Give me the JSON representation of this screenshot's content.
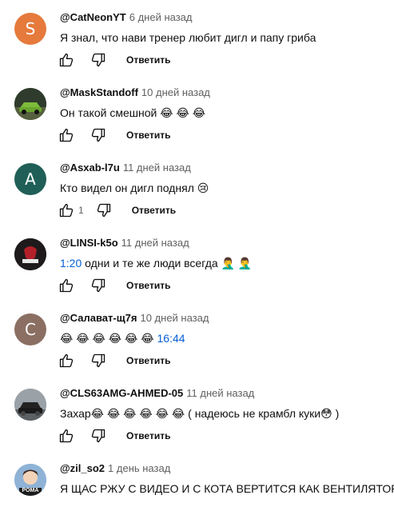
{
  "reply_label": "Ответить",
  "colors": {
    "link": "#065fd4",
    "muted": "#606060",
    "text": "#0f0f0f"
  },
  "comments": [
    {
      "author": "@CatNeonYT",
      "time": "6 дней назад",
      "text": "Я знал, что нави тренер любит дигл и папу гриба",
      "likes": "",
      "avatar_letter": "S",
      "avatar_color": "#e57a3c"
    },
    {
      "author": "@MaskStandoff",
      "time": "10 дней назад",
      "text": "Он такой смешной 😂 😂 😂",
      "likes": "",
      "avatar_letter": "",
      "avatar_color": "#3e5a3a",
      "avatar_icon": "green-car-photo"
    },
    {
      "author": "@Asxab-l7u",
      "time": "11 дней назад",
      "text": "Кто видел он дигл поднял 😢",
      "likes": "1",
      "avatar_letter": "A",
      "avatar_color": "#1f5f57"
    },
    {
      "author": "@LINSI-k5o",
      "time": "11 дней назад",
      "timestamp": "1:20",
      "text": " одни и те же люди всегда 🤦‍♂️ 🤦‍♂️",
      "likes": "",
      "avatar_letter": "",
      "avatar_color": "#2a2426",
      "avatar_icon": "dark-logo"
    },
    {
      "author": "@Салават-щ7я",
      "time": "10 дней назад",
      "text": "😂 😂 😂 😂 😂 😂 ",
      "timestamp": "16:44",
      "likes": "",
      "avatar_letter": "C",
      "avatar_color": "#8a6f62"
    },
    {
      "author": "@CLS63AMG-AHMED-05",
      "time": "11 дней назад",
      "text": "Захар😂 😂 😂 😂 😂 😂  ( надеюсь не крамбл куки😳 )",
      "likes": "",
      "avatar_letter": "",
      "avatar_color": "#6d7378",
      "avatar_icon": "car-photo"
    },
    {
      "author": "@zil_so2",
      "time": "1 день назад",
      "text": "Я ЩАС РЖУ С ВИДЕО И С КОТА ВЕРТИТСЯ КАК ВЕНТИЛЯТОР",
      "likes": "",
      "avatar_letter": "",
      "avatar_color": "#7fa3c9",
      "avatar_icon": "anime-avatar",
      "avatar_caption": "РОМА"
    }
  ]
}
